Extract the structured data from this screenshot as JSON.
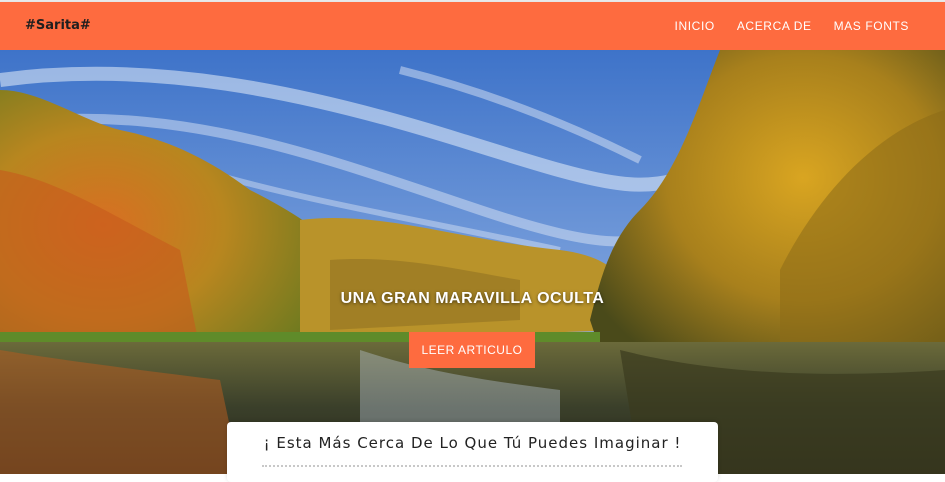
{
  "navbar": {
    "brand": "#Sarita#",
    "links": [
      "INICIO",
      "ACERCA DE",
      "MAS FONTS"
    ]
  },
  "hero": {
    "title": "UNA GRAN MARAVILLA OCULTA",
    "button_label": "LEER ARTICULO"
  },
  "card": {
    "title": "¡ Esta Más Cerca De Lo Que Tú Puedes Imaginar !"
  },
  "colors": {
    "accent": "#fe6b3f",
    "white": "#ffffff"
  }
}
